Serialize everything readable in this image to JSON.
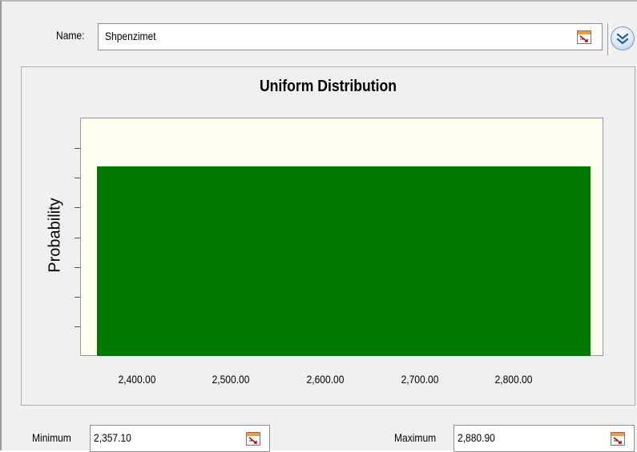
{
  "header": {
    "name_label": "Name:",
    "name_value": "Shpenzimet"
  },
  "icons": {
    "cell_reference": "cell-reference-icon",
    "expand": "double-chevron-down-icon"
  },
  "chart_data": {
    "type": "area",
    "title": "Uniform Distribution",
    "ylabel": "Probability",
    "xlabel": "",
    "distribution": "uniform",
    "min": 2357.1,
    "max": 2880.9,
    "xlim": [
      2340,
      2895
    ],
    "x_ticks": [
      2400,
      2500,
      2600,
      2700,
      2800
    ],
    "x_tick_labels": [
      "2,400.00",
      "2,500.00",
      "2,600.00",
      "2,700.00",
      "2,800.00"
    ],
    "colors": {
      "bar": "#007a00",
      "plot_background": "#fffff0"
    }
  },
  "parameters": {
    "min_label": "Minimum",
    "min_value": "2,357.10",
    "max_label": "Maximum",
    "max_value": "2,880.90"
  }
}
